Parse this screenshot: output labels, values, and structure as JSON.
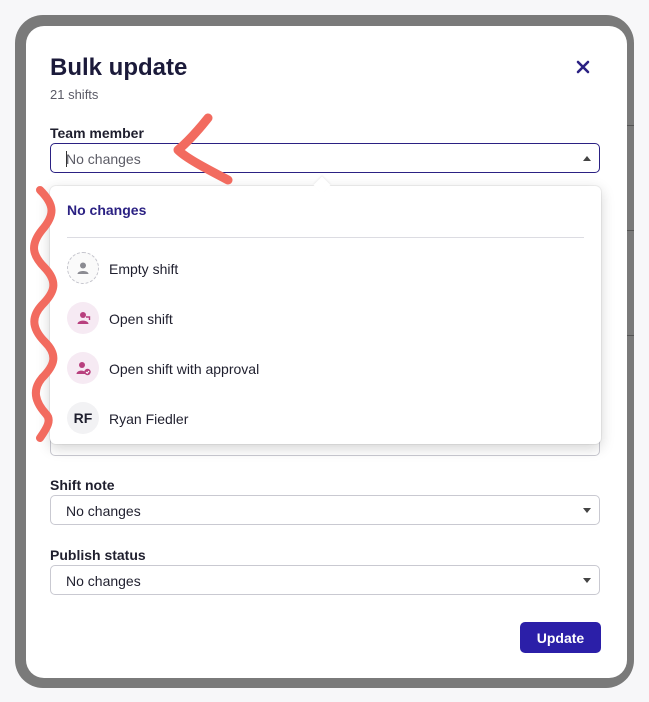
{
  "modal": {
    "title": "Bulk update",
    "subtitle": "21 shifts",
    "close_icon": "close-icon"
  },
  "fields": {
    "team_member": {
      "label": "Team member",
      "value": "No changes"
    },
    "shift_note": {
      "label": "Shift note",
      "value": "No changes"
    },
    "publish_status": {
      "label": "Publish status",
      "value": "No changes"
    }
  },
  "dropdown": {
    "selected_option": "No changes",
    "options": [
      {
        "label": "Empty shift",
        "icon": "person-icon"
      },
      {
        "label": "Open shift",
        "icon": "open-shift-icon"
      },
      {
        "label": "Open shift with approval",
        "icon": "open-shift-approval-icon"
      },
      {
        "label": "Ryan Fiedler",
        "initials": "RF"
      }
    ]
  },
  "actions": {
    "update_label": "Update"
  },
  "colors": {
    "accent": "#2b1fa8",
    "title": "#1b1a3a",
    "annotation": "#f26b5f",
    "open_shift_icon": "#b8407e"
  }
}
